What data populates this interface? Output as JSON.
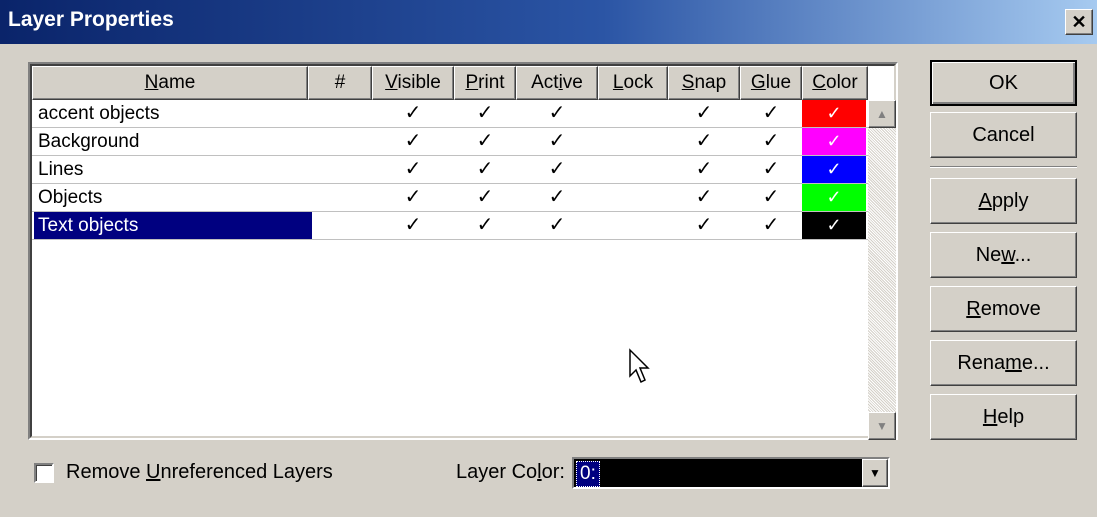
{
  "window": {
    "title": "Layer Properties",
    "close_glyph": "✕"
  },
  "columns": {
    "name": "Name",
    "number": "#",
    "visible": "Visible",
    "print": "Print",
    "active": "Active",
    "lock": "Lock",
    "snap": "Snap",
    "glue": "Glue",
    "color": "Color"
  },
  "check_glyph": "✓",
  "layers": [
    {
      "name": "accent objects",
      "visible": true,
      "print": true,
      "active": true,
      "lock": false,
      "snap": true,
      "glue": true,
      "color": "#ff0000"
    },
    {
      "name": "Background",
      "visible": true,
      "print": true,
      "active": true,
      "lock": false,
      "snap": true,
      "glue": true,
      "color": "#ff00ff"
    },
    {
      "name": "Lines",
      "visible": true,
      "print": true,
      "active": true,
      "lock": false,
      "snap": true,
      "glue": true,
      "color": "#0000ff"
    },
    {
      "name": "Objects",
      "visible": true,
      "print": true,
      "active": true,
      "lock": false,
      "snap": true,
      "glue": true,
      "color": "#00ff00"
    },
    {
      "name": "Text objects",
      "visible": true,
      "print": true,
      "active": true,
      "lock": false,
      "snap": true,
      "glue": true,
      "color": "#000000",
      "selected": true
    }
  ],
  "buttons": {
    "ok": "OK",
    "cancel": "Cancel",
    "apply": "Apply",
    "new": "New...",
    "remove": "Remove",
    "rename": "Rename...",
    "help": "Help"
  },
  "remove_unreferenced": {
    "label": "Remove Unreferenced Layers",
    "checked": false
  },
  "layer_color": {
    "label": "Layer Color:",
    "value": "0:"
  }
}
